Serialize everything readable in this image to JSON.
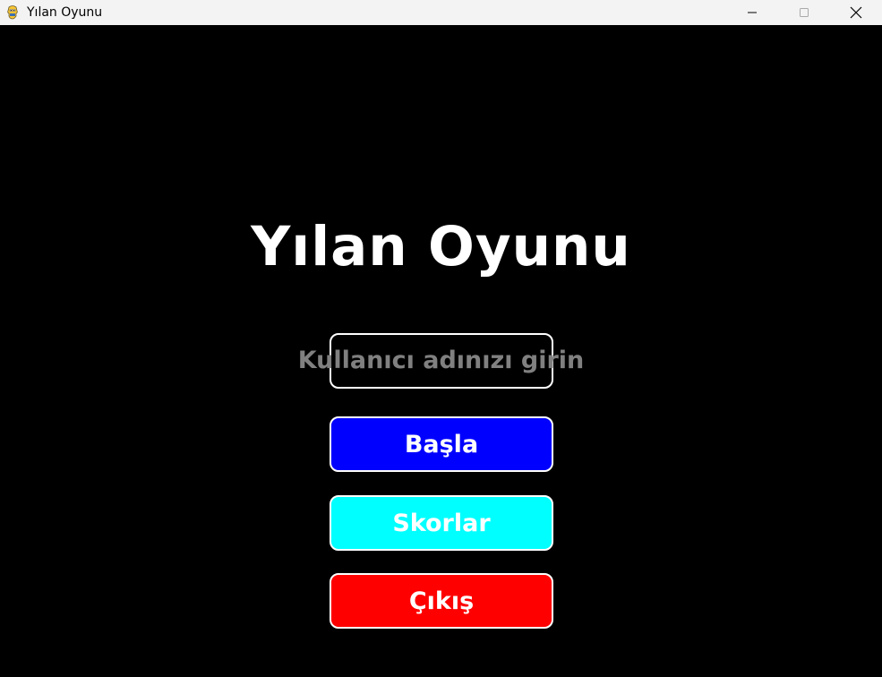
{
  "window": {
    "title": "Yılan Oyunu",
    "icon": "pygame-snake-icon",
    "controls": [
      "minimize-icon",
      "maximize-icon",
      "close-icon"
    ]
  },
  "main": {
    "title": "Yılan Oyunu",
    "username_input": {
      "value": "",
      "placeholder": "Kullanıcı adınızı girin"
    },
    "buttons": [
      {
        "label": "Başla",
        "color": "#0000ff"
      },
      {
        "label": "Skorlar",
        "color": "#00ffff"
      },
      {
        "label": "Çıkış",
        "color": "#ff0000"
      }
    ]
  },
  "colors": {
    "background": "#000000",
    "text": "#ffffff",
    "placeholder": "#808080",
    "border": "#ffffff"
  }
}
